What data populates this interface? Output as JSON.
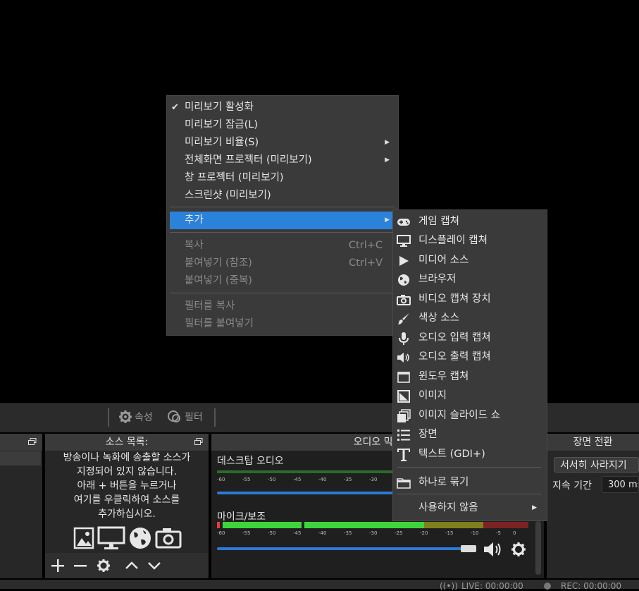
{
  "toolbar": {
    "properties_label": "속성",
    "filters_label": "필터"
  },
  "sources": {
    "header": "소스 목록:",
    "empty_lines": [
      "방송이나 녹화에 송출할 소스가",
      "지정되어 있지 않습니다.",
      "아래 + 버튼을 누르거나",
      "여기를 우클릭하여 소스를",
      "추가하십시오."
    ]
  },
  "mixer": {
    "header": "오디오 믹서",
    "tracks": [
      {
        "name": "데스크탑 오디오",
        "volume_fraction": 0.0
      },
      {
        "name": "마이크/보조",
        "volume_fraction": 0.8
      }
    ],
    "scale": [
      "-60",
      "-55",
      "-50",
      "-45",
      "-40",
      "-35",
      "-30",
      "-25",
      "-20",
      "-15",
      "-10",
      "-5",
      "0"
    ]
  },
  "transitions": {
    "header": "장면 전환",
    "selected": "서서히 사라지기",
    "duration_label": "지속 기간",
    "duration_value": "300 ms"
  },
  "status": {
    "live": "LIVE: 00:00:00",
    "rec": "REC: 00:00:00"
  },
  "context_menu": {
    "items": [
      {
        "label": "미리보기 활성화",
        "checked": true
      },
      {
        "label": "미리보기 잠금(L)"
      },
      {
        "label": "미리보기 비율(S)",
        "submenu": true
      },
      {
        "label": "전체화면 프로젝터 (미리보기)",
        "submenu": true
      },
      {
        "label": "창 프로젝터 (미리보기)"
      },
      {
        "label": "스크린샷 (미리보기)"
      },
      {
        "label": "추가",
        "submenu": true,
        "highlighted": true
      },
      {
        "label": "복사",
        "shortcut": "Ctrl+C",
        "disabled": true
      },
      {
        "label": "붙여넣기 (참조)",
        "shortcut": "Ctrl+V",
        "disabled": true
      },
      {
        "label": "붙여넣기 (중복)",
        "disabled": true
      },
      {
        "label": "필터를 복사",
        "disabled": true
      },
      {
        "label": "필터를 붙여넣기",
        "disabled": true
      }
    ],
    "check_glyph": "✔",
    "arrow_glyph": "▶"
  },
  "add_submenu": {
    "items": [
      {
        "label": "게임 캡쳐",
        "icon": "gamepad-icon"
      },
      {
        "label": "디스플레이 캡쳐",
        "icon": "monitor-icon"
      },
      {
        "label": "미디어 소스",
        "icon": "play-icon"
      },
      {
        "label": "브라우저",
        "icon": "globe-icon"
      },
      {
        "label": "비디오 캡쳐 장치",
        "icon": "camera-icon"
      },
      {
        "label": "색상 소스",
        "icon": "brush-icon"
      },
      {
        "label": "오디오 입력 캡쳐",
        "icon": "microphone-icon"
      },
      {
        "label": "오디오 출력 캡쳐",
        "icon": "speaker-icon"
      },
      {
        "label": "윈도우 캡쳐",
        "icon": "window-icon"
      },
      {
        "label": "이미지",
        "icon": "image-icon"
      },
      {
        "label": "이미지 슬라이드 쇼",
        "icon": "slideshow-icon"
      },
      {
        "label": "장면",
        "icon": "list-icon"
      },
      {
        "label": "텍스트 (GDI+)",
        "icon": "text-icon"
      },
      {
        "label": "하나로 묶기",
        "icon": "folder-icon"
      },
      {
        "label": "사용하지 않음",
        "submenu": true
      }
    ]
  }
}
